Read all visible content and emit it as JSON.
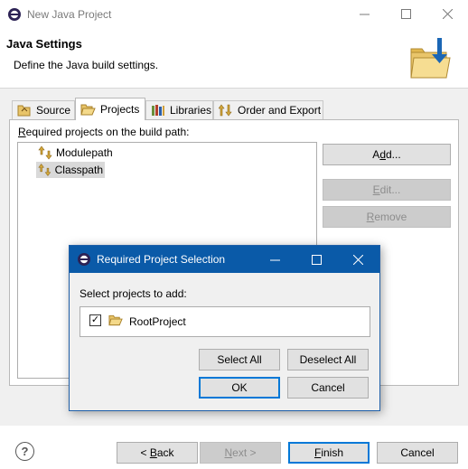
{
  "window": {
    "title": "New Java Project",
    "minimize_icon": "minimize-icon",
    "maximize_icon": "maximize-icon",
    "close_icon": "close-icon"
  },
  "header": {
    "title": "Java Settings",
    "description": "Define the Java build settings."
  },
  "tabs": [
    {
      "label": "Source",
      "icon": "source-folder-icon"
    },
    {
      "label": "Projects",
      "icon": "projects-folder-icon",
      "active": true
    },
    {
      "label": "Libraries",
      "icon": "libraries-icon"
    },
    {
      "label": "Order and Export",
      "icon": "order-export-icon"
    }
  ],
  "projects_tab": {
    "label_prefix": "R",
    "label_rest": "equired projects on the build path:",
    "tree": [
      {
        "label": "Modulepath",
        "icon": "classpath-container-icon",
        "selected": false
      },
      {
        "label": "Classpath",
        "icon": "classpath-container-icon",
        "selected": true
      }
    ],
    "add_pre": "A",
    "add_mn": "d",
    "add_post": "d...",
    "edit_mn": "E",
    "edit_post": "dit...",
    "remove_mn": "R",
    "remove_post": "emove"
  },
  "footer": {
    "help_glyph": "?",
    "back_pre": "< ",
    "back_mn": "B",
    "back_post": "ack",
    "next_mn": "N",
    "next_post": "ext >",
    "finish_mn": "F",
    "finish_post": "inish",
    "cancel": "Cancel"
  },
  "dialog": {
    "title": "Required Project Selection",
    "label": "Select projects to add:",
    "items": [
      {
        "label": "RootProject",
        "checked": true,
        "check_glyph": "✓"
      }
    ],
    "select_all": "Select All",
    "deselect_all": "Deselect All",
    "ok": "OK",
    "cancel": "Cancel"
  },
  "colors": {
    "dialog_titlebar": "#0a5aa8",
    "default_button_border": "#0078d7",
    "panel_background": "#f0f0f0"
  }
}
